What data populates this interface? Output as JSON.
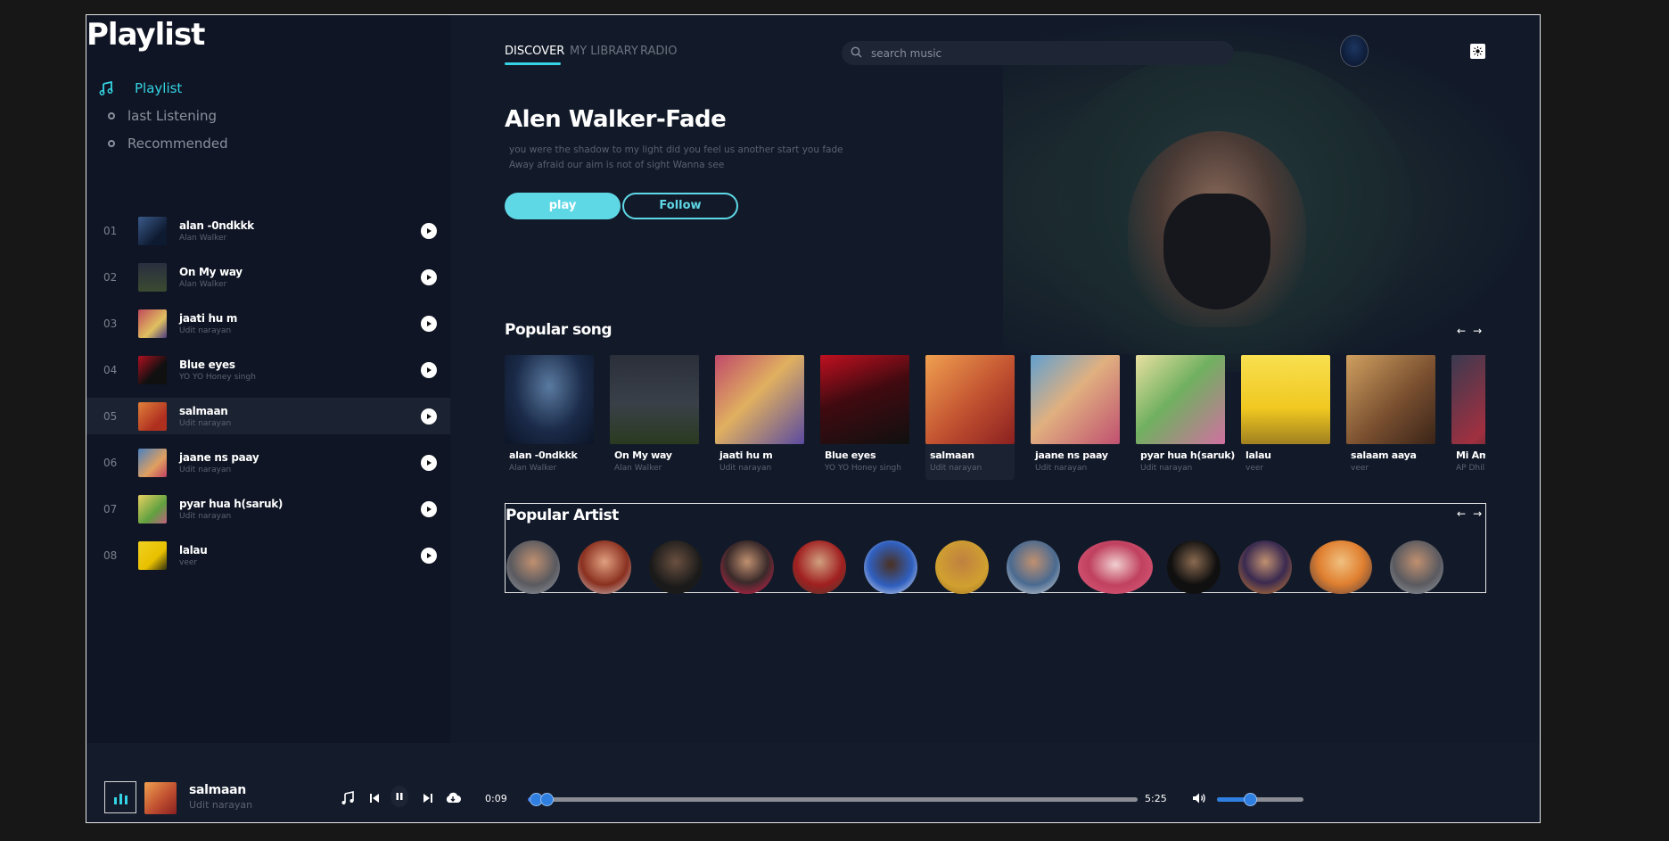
{
  "app": {
    "title": "Playlist"
  },
  "sidebar": {
    "nav": [
      {
        "label": "Playlist",
        "active": true
      },
      {
        "label": "last Listening",
        "active": false
      },
      {
        "label": "Recommended",
        "active": false
      }
    ],
    "tracks": [
      {
        "num": "01",
        "title": "alan -0ndkkk",
        "artist": "Alan Walker"
      },
      {
        "num": "02",
        "title": "On My way",
        "artist": "Alan Walker"
      },
      {
        "num": "03",
        "title": "jaati hu m",
        "artist": "Udit narayan"
      },
      {
        "num": "04",
        "title": "Blue eyes",
        "artist": "YO YO Honey singh"
      },
      {
        "num": "05",
        "title": "salmaan",
        "artist": "Udit narayan",
        "active": true
      },
      {
        "num": "06",
        "title": "jaane ns paay",
        "artist": "Udit narayan"
      },
      {
        "num": "07",
        "title": "pyar hua h(saruk)",
        "artist": "Udit narayan"
      },
      {
        "num": "08",
        "title": "lalau",
        "artist": "veer"
      }
    ]
  },
  "header": {
    "tabs": [
      {
        "label": "DISCOVER",
        "active": true
      },
      {
        "label": "MY LIBRARY",
        "active": false
      },
      {
        "label": "RADIO",
        "active": false
      }
    ],
    "search_placeholder": "search music"
  },
  "hero": {
    "title": "Alen Walker-Fade",
    "lyrics_line1": "you were the shadow to my light did you feel us another start you fade",
    "lyrics_line2": "Away afraid our aim is not of sight Wanna see",
    "play_label": "play",
    "follow_label": "Follow"
  },
  "popular_songs": {
    "title": "Popular song",
    "items": [
      {
        "title": "alan -0ndkkk",
        "artist": "Alan Walker"
      },
      {
        "title": "On My way",
        "artist": "Alan Walker"
      },
      {
        "title": "jaati hu m",
        "artist": "Udit narayan"
      },
      {
        "title": "Blue eyes",
        "artist": "YO YO Honey singh"
      },
      {
        "title": "salmaan",
        "artist": "Udit narayan",
        "active": true
      },
      {
        "title": "jaane ns paay",
        "artist": "Udit narayan"
      },
      {
        "title": "pyar hua h(saruk)",
        "artist": "Udit narayan"
      },
      {
        "title": "lalau",
        "artist": "veer"
      },
      {
        "title": "salaam aaya",
        "artist": "veer"
      },
      {
        "title": "Mi Amor",
        "artist": "AP Dhillon"
      }
    ]
  },
  "popular_artists": {
    "title": "Popular Artist"
  },
  "player": {
    "title": "salmaan",
    "artist": "Udit narayan",
    "current_time": "0:09",
    "duration": "5:25",
    "progress": 0.03,
    "volume": 0.38
  },
  "colors": {
    "accent": "#35d4e4",
    "bg": "#0f1524",
    "slider": "#2e7fe0"
  },
  "icons": [
    "music-note-icon",
    "search-icon",
    "play-icon",
    "pause-icon",
    "previous-icon",
    "next-icon",
    "download-icon",
    "volume-icon",
    "arrow-left-icon",
    "arrow-right-icon",
    "theme-icon",
    "equalizer-icon"
  ]
}
